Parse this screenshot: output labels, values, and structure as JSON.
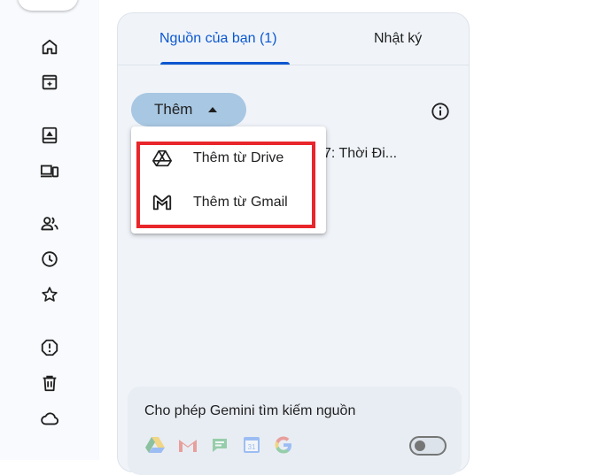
{
  "rail": {
    "icons": [
      "home-icon",
      "inbox-add-icon",
      "drive-device-icon",
      "computers-icon",
      "shared-icon",
      "recent-icon",
      "starred-icon",
      "spam-icon",
      "trash-icon",
      "storage-cloud-icon"
    ]
  },
  "panel": {
    "tabs": [
      {
        "label": "Nguồn của bạn (1)",
        "active": true
      },
      {
        "label": "Nhật ký",
        "active": false
      }
    ],
    "add_button": {
      "label": "Thêm"
    },
    "source_item_text": "7: Thời Đi...",
    "accent_color": "#0b57d0"
  },
  "menu": {
    "items": [
      {
        "label": "Thêm từ Drive",
        "icon": "drive-icon"
      },
      {
        "label": "Thêm từ Gmail",
        "icon": "gmail-icon"
      }
    ],
    "highlight_color": "#e8262b"
  },
  "gemini": {
    "title": "Cho phép Gemini tìm kiếm nguồn",
    "icons": [
      "drive-icon",
      "gmail-icon",
      "chat-icon",
      "calendar-icon",
      "google-icon"
    ],
    "calendar_day": "31",
    "toggle_on": false
  }
}
